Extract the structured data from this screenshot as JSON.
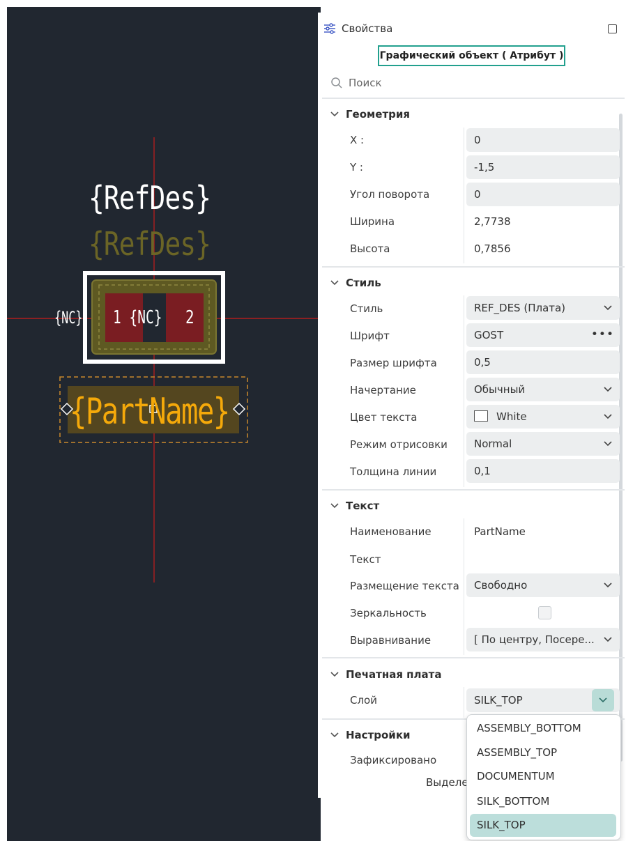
{
  "canvas": {
    "refdes_label": "{RefDes}",
    "refdes_shadow_label": "{RefDes}",
    "nc_label": "{NC}",
    "pad1_label": "1 {NC}",
    "pad2_label": "2",
    "partname_label": "{PartName}"
  },
  "panel": {
    "title": "Свойства",
    "object_title": "Графический объект ( Атрибут )",
    "search_placeholder": "Поиск",
    "sections": {
      "geometry": {
        "title": "Геометрия",
        "x_label": "X :",
        "x_value": "0",
        "y_label": "Y :",
        "y_value": "-1,5",
        "angle_label": "Угол поворота",
        "angle_value": "0",
        "width_label": "Ширина",
        "width_value": "2,7738",
        "height_label": "Высота",
        "height_value": "0,7856"
      },
      "style": {
        "title": "Стиль",
        "style_label": "Стиль",
        "style_value": "REF_DES (Плата)",
        "font_label": "Шрифт",
        "font_value": "GOST",
        "font_more": "•••",
        "size_label": "Размер шрифта",
        "size_value": "0,5",
        "face_label": "Начертание",
        "face_value": "Обычный",
        "color_label": "Цвет текста",
        "color_value": "White",
        "mode_label": "Режим отрисовки",
        "mode_value": "Normal",
        "line_label": "Толщина линии",
        "line_value": "0,1"
      },
      "text": {
        "title": "Текст",
        "name_label": "Наименование",
        "name_value": "PartName",
        "text_label": "Текст",
        "placement_label": "Размещение текста",
        "placement_value": "Свободно",
        "mirror_label": "Зеркальность",
        "align_label": "Выравнивание",
        "align_value": "[ По центру, Посере..."
      },
      "pcb": {
        "title": "Печатная плата",
        "layer_label": "Слой",
        "layer_value": "SILK_TOP"
      },
      "settings": {
        "title": "Настройки",
        "locked_label": "Зафиксировано"
      }
    },
    "footer_text": "Выделе"
  },
  "layer_dropdown": {
    "options": [
      "ASSEMBLY_BOTTOM",
      "ASSEMBLY_TOP",
      "DOCUMENTUM",
      "SILK_BOTTOM",
      "SILK_TOP"
    ],
    "selected": "SILK_TOP"
  },
  "colors": {
    "canvas_bg": "#212730",
    "crosshair": "#b01e1e",
    "partname": "#f5a90a",
    "pad": "#7a1d22",
    "accent": "#22a08e",
    "selected_option": "#bcdedb"
  }
}
